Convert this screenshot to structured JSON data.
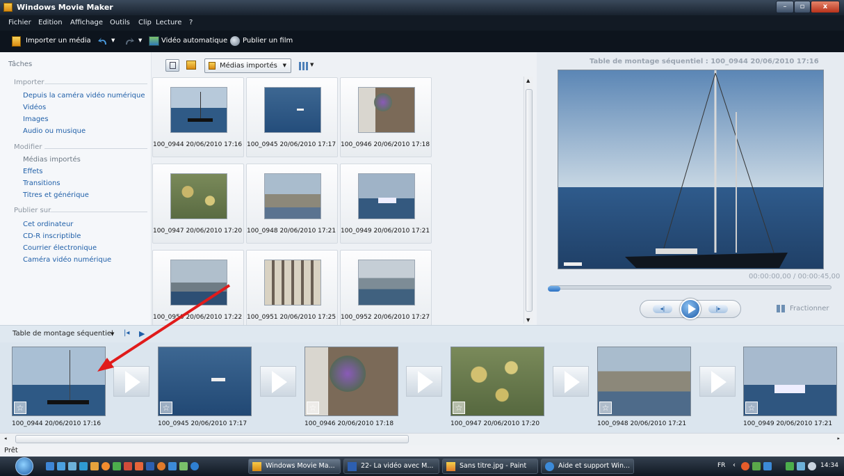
{
  "window": {
    "title": "Windows Movie Maker",
    "min": "–",
    "max": "▫",
    "close": "x"
  },
  "menu": [
    "Fichier",
    "Edition",
    "Affichage",
    "Outils",
    "Clip",
    "Lecture",
    "?"
  ],
  "toolbar": {
    "import": "Importer un média",
    "auto_video": "Vidéo automatique",
    "publish": "Publier un film"
  },
  "tasks": {
    "header": "Tâches",
    "import_title": "Importer",
    "import_links": [
      "Depuis la caméra vidéo numérique",
      "Vidéos",
      "Images",
      "Audio ou musique"
    ],
    "edit_title": "Modifier",
    "edit_links": [
      "Médias importés",
      "Effets",
      "Transitions",
      "Titres et générique"
    ],
    "publish_title": "Publier sur",
    "publish_links": [
      "Cet ordinateur",
      "CD-R inscriptible",
      "Courrier électronique",
      "Caméra vidéo numérique"
    ]
  },
  "collection": {
    "dropdown": "Médias importés",
    "items": [
      "100_0944 20/06/2010 17:16",
      "100_0945 20/06/2010 17:17",
      "100_0946 20/06/2010 17:18",
      "100_0947 20/06/2010 17:20",
      "100_0948 20/06/2010 17:21",
      "100_0949 20/06/2010 17:21",
      "100_0950 20/06/2010 17:22",
      "100_0951 20/06/2010 17:25",
      "100_0952 20/06/2010 17:27"
    ]
  },
  "preview": {
    "title": "Table de montage séquentiel : 100_0944 20/06/2010 17:16",
    "timecode": "00:00:00,00 / 00:00:45,00",
    "split": "Fractionner",
    "progress": 0
  },
  "storyboard": {
    "label": "Table de montage séquentiel",
    "items": [
      "100_0944 20/06/2010 17:16",
      "100_0945 20/06/2010 17:17",
      "100_0946 20/06/2010 17:18",
      "100_0947 20/06/2010 17:20",
      "100_0948 20/06/2010 17:21",
      "100_0949 20/06/2010 17:21"
    ]
  },
  "status": "Prêt",
  "taskbar": {
    "items": [
      "Windows Movie Ma...",
      "22- La vidéo avec M...",
      "Sans titre.jpg - Paint",
      "Aide et support Win..."
    ],
    "lang": "FR",
    "clock": "14:34"
  },
  "colors": {
    "accent": "#1f5fa8",
    "arrow": "#e01b1b"
  }
}
